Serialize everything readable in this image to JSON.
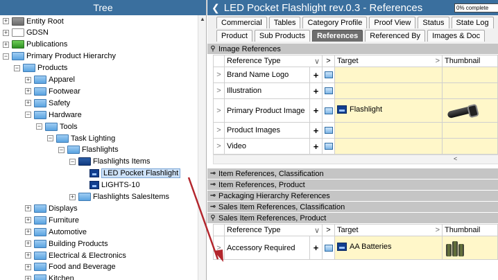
{
  "tree": {
    "title": "Tree",
    "nodes": [
      {
        "label": "Entity Root",
        "toggle": "+",
        "icon": "gray"
      },
      {
        "label": "GDSN",
        "toggle": "+",
        "icon": "gray-outline"
      },
      {
        "label": "Publications",
        "toggle": "+",
        "icon": "green"
      },
      {
        "label": "Primary Product Hierarchy",
        "toggle": "−",
        "icon": "folder"
      },
      {
        "label": "Products",
        "toggle": "−",
        "icon": "folder"
      },
      {
        "label": "Apparel",
        "toggle": "+",
        "icon": "folder"
      },
      {
        "label": "Footwear",
        "toggle": "+",
        "icon": "folder"
      },
      {
        "label": "Safety",
        "toggle": "+",
        "icon": "folder"
      },
      {
        "label": "Hardware",
        "toggle": "−",
        "icon": "folder"
      },
      {
        "label": "Tools",
        "toggle": "−",
        "icon": "folder"
      },
      {
        "label": "Task Lighting",
        "toggle": "−",
        "icon": "folder"
      },
      {
        "label": "Flashlights",
        "toggle": "−",
        "icon": "folder"
      },
      {
        "label": "Flashlights Items",
        "toggle": "−",
        "icon": "dark"
      },
      {
        "label": "LED Pocket Flashlight",
        "toggle": "",
        "icon": "item"
      },
      {
        "label": "LIGHTS-10",
        "toggle": "",
        "icon": "item"
      },
      {
        "label": "Flashlights SalesItems",
        "toggle": "+",
        "icon": "folder"
      },
      {
        "label": "Displays",
        "toggle": "+",
        "icon": "folder"
      },
      {
        "label": "Furniture",
        "toggle": "+",
        "icon": "folder"
      },
      {
        "label": "Automotive",
        "toggle": "+",
        "icon": "folder"
      },
      {
        "label": "Building Products",
        "toggle": "+",
        "icon": "folder"
      },
      {
        "label": "Electrical & Electronics",
        "toggle": "+",
        "icon": "folder"
      },
      {
        "label": "Food and Beverage",
        "toggle": "+",
        "icon": "folder"
      },
      {
        "label": "Kitchen",
        "toggle": "+",
        "icon": "folder"
      }
    ]
  },
  "header": {
    "back": "❮",
    "title": "LED Pocket Flashlight rev.0.3 - References",
    "progress": "0% complete"
  },
  "tabs_row1": [
    "Commercial",
    "Tables",
    "Category Profile",
    "Proof View",
    "Status",
    "State Log"
  ],
  "tabs_row2": [
    "Product",
    "Sub Products",
    "References",
    "Referenced By",
    "Images & Doc"
  ],
  "active_tab": "References",
  "sections": {
    "image_refs": "Image References",
    "item_class": "Item References, Classification",
    "item_product": "Item References, Product",
    "packaging": "Packaging Hierarchy References",
    "sales_class": "Sales Item References, Classification",
    "sales_product": "Sales Item References, Product"
  },
  "columns": {
    "ref_type": "Reference Type",
    "target": "Target",
    "thumbnail": "Thumbnail"
  },
  "image_rows": [
    {
      "type": "Brand Name Logo",
      "target": ""
    },
    {
      "type": "Illustration",
      "target": ""
    },
    {
      "type": "Primary Product Image",
      "target": "Flashlight"
    },
    {
      "type": "Product Images",
      "target": ""
    },
    {
      "type": "Video",
      "target": ""
    }
  ],
  "sales_rows": [
    {
      "type": "Accessory Required",
      "target": "AA Batteries"
    }
  ],
  "glyphs": {
    "expand": ">",
    "add": "+",
    "dropdown": "∨",
    "scroll_left": "<",
    "scroll_up": "▲"
  }
}
